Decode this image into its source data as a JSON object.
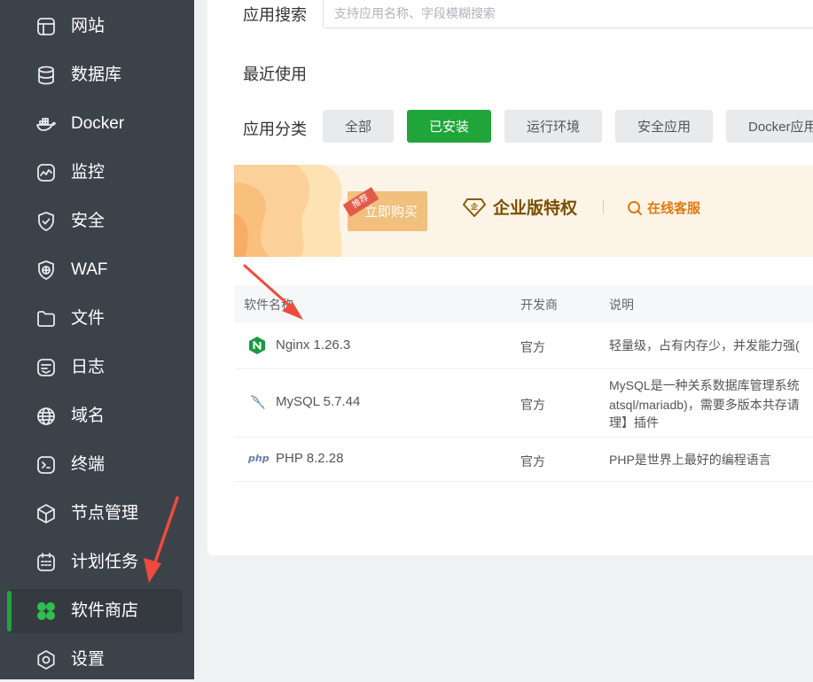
{
  "sidebar": {
    "items": [
      {
        "label": "网站",
        "icon": "website-icon"
      },
      {
        "label": "数据库",
        "icon": "database-icon"
      },
      {
        "label": "Docker",
        "icon": "docker-icon"
      },
      {
        "label": "监控",
        "icon": "monitor-icon"
      },
      {
        "label": "安全",
        "icon": "shield-icon"
      },
      {
        "label": "WAF",
        "icon": "waf-icon"
      },
      {
        "label": "文件",
        "icon": "folder-icon"
      },
      {
        "label": "日志",
        "icon": "log-icon"
      },
      {
        "label": "域名",
        "icon": "globe-icon"
      },
      {
        "label": "终端",
        "icon": "terminal-icon"
      },
      {
        "label": "节点管理",
        "icon": "cube-icon"
      },
      {
        "label": "计划任务",
        "icon": "calendar-icon"
      },
      {
        "label": "软件商店",
        "icon": "clover-icon",
        "active": true
      },
      {
        "label": "设置",
        "icon": "gear-icon"
      }
    ]
  },
  "search": {
    "label": "应用搜索",
    "placeholder": "支持应用名称、字段模糊搜索",
    "value": ""
  },
  "recent": {
    "label": "最近使用"
  },
  "categories": {
    "label": "应用分类",
    "items": [
      {
        "label": "全部"
      },
      {
        "label": "已安装",
        "selected": true
      },
      {
        "label": "运行环境"
      },
      {
        "label": "安全应用"
      },
      {
        "label": "Docker应用"
      }
    ]
  },
  "banner": {
    "tag": "推荐",
    "buy_label": "立即购买",
    "vip_label": "企业版特权",
    "service_label": "在线客服"
  },
  "table": {
    "headers": {
      "name": "软件名称",
      "developer": "开发商",
      "description": "说明"
    },
    "rows": [
      {
        "name": "Nginx 1.26.3",
        "developer": "官方",
        "description": "轻量级，占有内存少，并发能力强(",
        "icon": "nginx-icon"
      },
      {
        "name": "MySQL 5.7.44",
        "developer": "官方",
        "description_lines": [
          "MySQL是一种关系数据库管理系统",
          "atsql/mariadb)，需要多版本共存请",
          "理】插件"
        ],
        "icon": "mysql-icon"
      },
      {
        "name": "PHP 8.2.28",
        "developer": "官方",
        "description": "PHP是世界上最好的编程语言",
        "icon": "php-icon"
      }
    ]
  },
  "colors": {
    "accent": "#20a53a",
    "sidebar_bg": "#3c424a",
    "annotation_arrow": "#f04a3e"
  }
}
